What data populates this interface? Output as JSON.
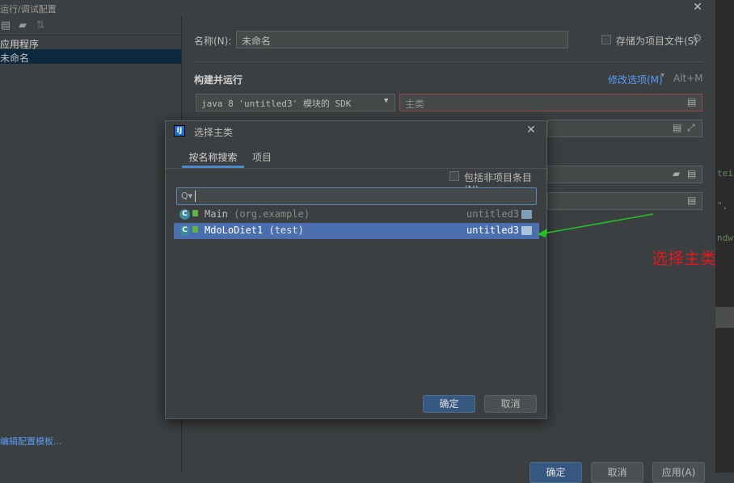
{
  "window": {
    "title": "运行/调试配置"
  },
  "left_panel": {
    "tree_group": "应用程序",
    "tree_item": "未命名",
    "templates_link": "编辑配置模板..."
  },
  "config": {
    "name_label": "名称(N):",
    "name_value": "未命名",
    "store_checkbox_label": "存储为项目文件(S)",
    "section_title": "构建并运行",
    "modify_options": "修改选项(M)",
    "modify_shortcut": "Alt+M",
    "sdk_value": "java 8 'untitled3' 模块的 SDK",
    "main_class_placeholder": "主类"
  },
  "code_strip": {
    "line1": "tei",
    "line2": "\",",
    "line3": "ndw"
  },
  "bottom_buttons": {
    "ok": "确定",
    "cancel": "取消",
    "apply": "应用(A)"
  },
  "dialog": {
    "title": "选择主类",
    "tabs": [
      "按名称搜索",
      "项目"
    ],
    "include_nonproject_label": "包括非项目条目(N)",
    "search_value": "",
    "results": [
      {
        "name": "Main",
        "package": "(org.example)",
        "module": "untitled3",
        "selected": false
      },
      {
        "name": "MdoLoDiet1",
        "package": "(test)",
        "module": "untitled3",
        "selected": true
      }
    ],
    "ok": "确定",
    "cancel": "取消"
  },
  "annotation": {
    "text": "选择主类",
    "color": "#e0181c",
    "arrow_color": "#22c322"
  }
}
